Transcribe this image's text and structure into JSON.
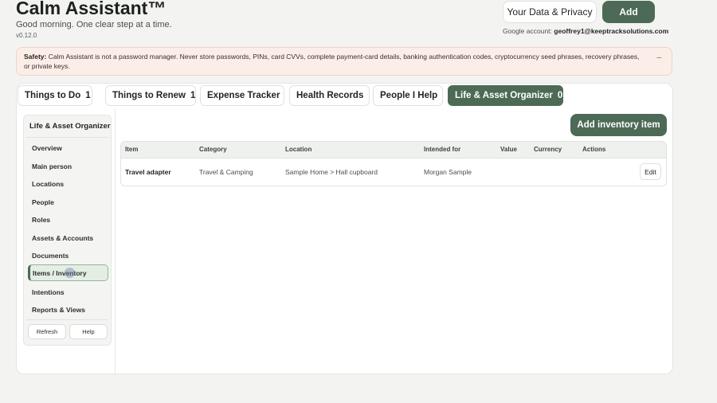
{
  "app": {
    "title": "Calm Assistant™",
    "subtitle": "Good morning. One clear step at a time.",
    "version": "v0.12.0"
  },
  "header": {
    "privacy_label": "Your Data & Privacy",
    "add_label": "Add",
    "account_prefix": "Google account:",
    "account_email": "geoffrey1@keeptracksolutions.com"
  },
  "safety": {
    "label": "Safety:",
    "text": "Calm Assistant is not a password manager. Never store passwords, PINs, card CVVs, complete payment-card details, banking authentication codes, cryptocurrency seed phrases, recovery phrases, or private keys.",
    "dismiss": "–"
  },
  "tabs": [
    {
      "label": "Things to Do",
      "count": "1"
    },
    {
      "label": "Things to Renew",
      "count": "1"
    },
    {
      "label": "Expense Tracker",
      "count": ""
    },
    {
      "label": "Health Records",
      "count": ""
    },
    {
      "label": "People I Help",
      "count": ""
    },
    {
      "label": "Life & Asset Organizer",
      "count": "0"
    }
  ],
  "sidebar": {
    "title": "Life & Asset Organizer",
    "items": [
      {
        "label": "Overview"
      },
      {
        "label": "Main person"
      },
      {
        "label": "Locations"
      },
      {
        "label": "People"
      },
      {
        "label": "Roles"
      },
      {
        "label": "Assets & Accounts"
      },
      {
        "label": "Documents"
      },
      {
        "label": "Items / Inventory"
      },
      {
        "label": "Intentions"
      },
      {
        "label": "Reports & Views"
      }
    ],
    "refresh_label": "Refresh",
    "help_label": "Help"
  },
  "main": {
    "add_inventory_label": "Add inventory item",
    "columns": [
      "Item",
      "Category",
      "Location",
      "Intended for",
      "Value",
      "Currency",
      "Actions"
    ],
    "rows": [
      {
        "item": "Travel adapter",
        "category": "Travel & Camping",
        "location": "Sample Home > Hall cupboard",
        "intended_for": "Morgan Sample",
        "value": "",
        "currency": "",
        "action_label": "Edit"
      }
    ]
  },
  "colors": {
    "accent": "#4c6a55",
    "safety_background": "#fbeee9",
    "page_background": "#f3f4f2"
  }
}
